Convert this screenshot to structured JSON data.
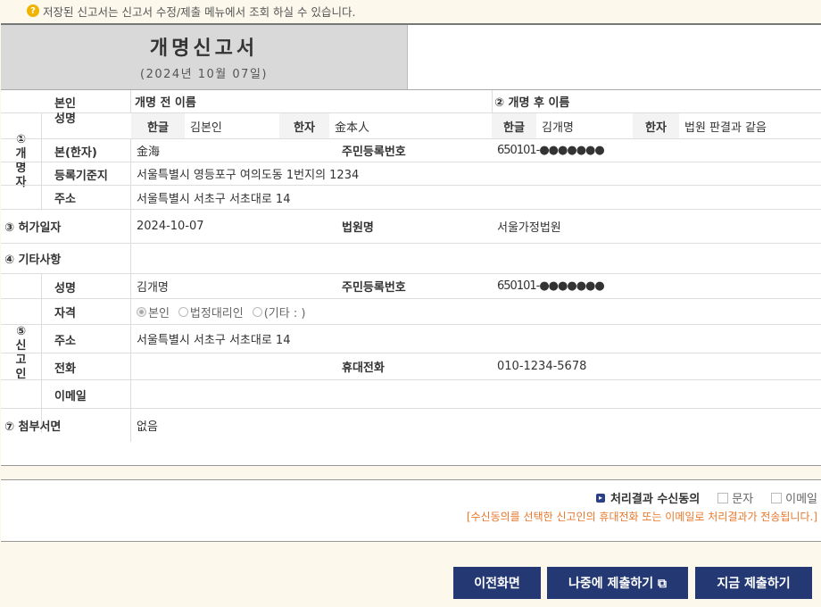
{
  "notice": {
    "icon": "question-icon",
    "text": "저장된 신고서는 신고서 수정/제출 메뉴에서 조회 하실 수 있습니다."
  },
  "title": {
    "main": "개명신고서",
    "date": "(2024년 10월 07일)"
  },
  "person": {
    "section_label": [
      "①",
      "개",
      "명",
      "자"
    ],
    "name_label_1": "본인",
    "name_label_2": "성명",
    "before_header": "개명 전 이름",
    "after_header": "② 개명 후 이름",
    "hangul_label": "한글",
    "hanja_label": "한자",
    "before_hangul": "김본인",
    "before_hanja": "金本人",
    "after_hangul_label": "한글",
    "after_hanja_label": "한자",
    "after_hangul": "김개명",
    "after_hanja": "법원 판결과 같음",
    "bon_label": "본(한자)",
    "bon_value": "金海",
    "rrn_label": "주민등록번호",
    "rrn_value": "650101-●●●●●●●",
    "reg_label": "등록기준지",
    "reg_value": "서울특별시 영등포구 여의도동 1번지의 1234",
    "addr_label": "주소",
    "addr_value": "서울특별시 서초구 서초대로 14"
  },
  "permit": {
    "label": "③ 허가일자",
    "value": "2024-10-07",
    "court_label": "법원명",
    "court_value": "서울가정법원"
  },
  "etc": {
    "label": "④ 기타사항",
    "value": ""
  },
  "reporter": {
    "section_label": [
      "⑤",
      "신",
      "고",
      "인"
    ],
    "name_label": "성명",
    "name_value": "김개명",
    "rrn_label": "주민등록번호",
    "rrn_value": "650101-●●●●●●●",
    "qual_label": "자격",
    "qual_options": [
      "본인",
      "법정대리인",
      "(기타 : )"
    ],
    "qual_selected": "본인",
    "addr_label": "주소",
    "addr_value": "서울특별시 서초구 서초대로 14",
    "phone_label": "전화",
    "phone_value": "",
    "mobile_label": "휴대전화",
    "mobile_value": "010-1234-5678",
    "email_label": "이메일",
    "email_value": ""
  },
  "attach": {
    "label": "⑦ 첨부서면",
    "value": "없음"
  },
  "consent": {
    "label": "처리결과 수신동의",
    "option_sms": "문자",
    "option_email": "이메일",
    "note": "[수신동의를 선택한 신고인의 휴대전화 또는 이메일로 처리결과가 전송됩니다.]"
  },
  "buttons": {
    "prev": "이전화면",
    "later": "나중에 제출하기 ⧉",
    "submit": "지금 제출하기"
  },
  "colors": {
    "button_bg": "#243874",
    "note_orange": "#e8782c",
    "page_bg": "#fcf8ec"
  }
}
